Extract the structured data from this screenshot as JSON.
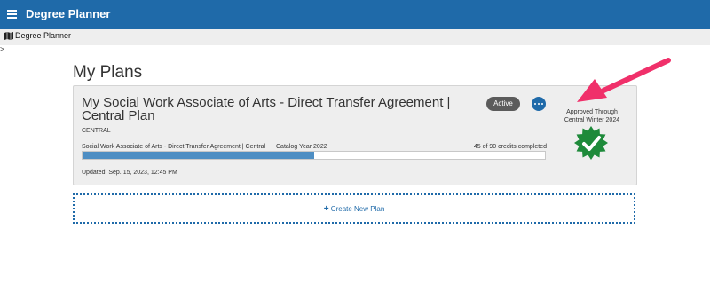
{
  "app": {
    "title": "Degree Planner"
  },
  "breadcrumb": {
    "label": "Degree Planner",
    "icon": "map-icon"
  },
  "stray_text": ">",
  "page": {
    "heading": "My Plans"
  },
  "plan": {
    "title": "My Social Work Associate of Arts - Direct Transfer Agreement | Central Plan",
    "campus": "CENTRAL",
    "status": "Active",
    "program": "Social Work Associate of Arts - Direct Transfer Agreement | Central",
    "catalog_year": "Catalog Year 2022",
    "credits_text": "45 of 90 credits completed",
    "progress_fraction": 0.5,
    "updated": "Updated: Sep. 15, 2023, 12:45 PM",
    "approval": "Approved Through Central Winter 2024",
    "seal_icon": "approved-seal-icon"
  },
  "create": {
    "plus": "+",
    "label": "Create New Plan"
  },
  "colors": {
    "header": "#1f6aa9",
    "progress": "#4e8ec3",
    "seal": "#1e8a3a",
    "arrow": "#f0306a"
  }
}
